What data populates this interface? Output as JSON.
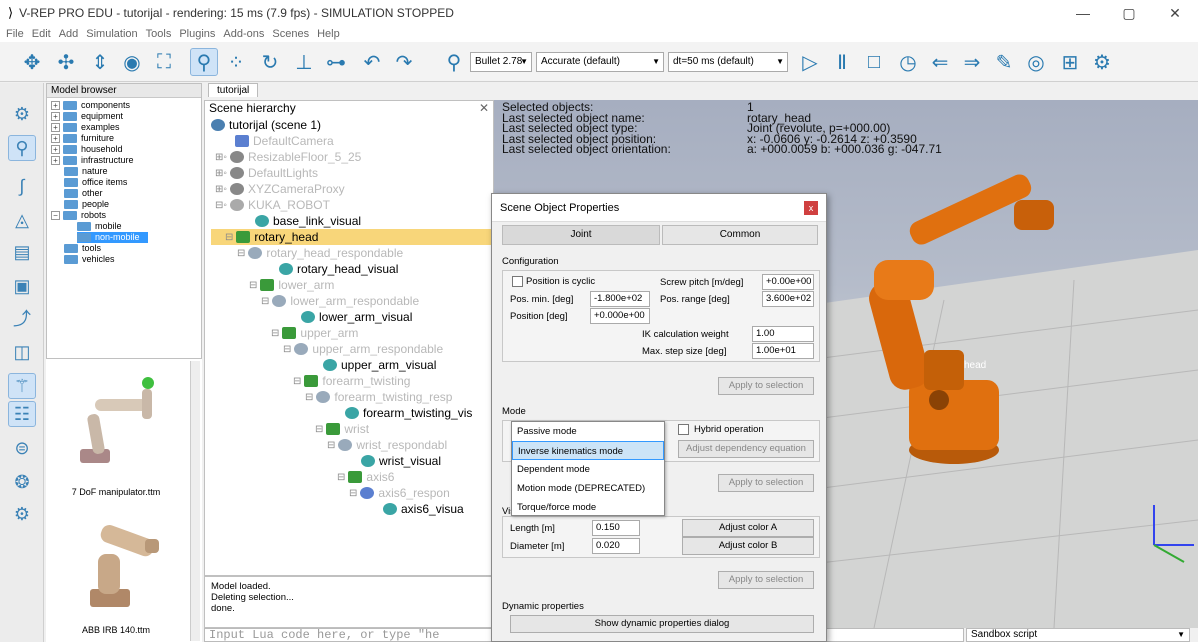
{
  "window": {
    "title": "V-REP PRO EDU - tutorijal - rendering: 15 ms (7.9 fps) - SIMULATION STOPPED",
    "controls": [
      "—",
      "▢",
      "✕"
    ]
  },
  "menu": [
    "File",
    "Edit",
    "Add",
    "Simulation",
    "Tools",
    "Plugins",
    "Add-ons",
    "Scenes",
    "Help"
  ],
  "toolbar": {
    "engine": "Bullet 2.78",
    "accuracy": "Accurate (default)",
    "timestep": "dt=50 ms (default)"
  },
  "model_browser": {
    "header": "Model browser",
    "items": [
      {
        "label": "components",
        "expander": "+"
      },
      {
        "label": "equipment",
        "expander": "+"
      },
      {
        "label": "examples",
        "expander": "+"
      },
      {
        "label": "furniture",
        "expander": "+"
      },
      {
        "label": "household",
        "expander": "+"
      },
      {
        "label": "infrastructure",
        "expander": "+"
      },
      {
        "label": "nature",
        "expander": ""
      },
      {
        "label": "office items",
        "expander": ""
      },
      {
        "label": "other",
        "expander": ""
      },
      {
        "label": "people",
        "expander": ""
      },
      {
        "label": "robots",
        "expander": "−"
      },
      {
        "label": "mobile",
        "expander": ""
      },
      {
        "label": "non-mobile",
        "expander": ""
      },
      {
        "label": "tools",
        "expander": ""
      },
      {
        "label": "vehicles",
        "expander": ""
      }
    ],
    "thumbs": [
      "7 DoF manipulator.ttm",
      "ABB IRB 140.ttm"
    ]
  },
  "scene_tab": "tutorijal",
  "hierarchy": {
    "title": "Scene hierarchy",
    "close": "✕",
    "nodes": [
      "tutorijal (scene 1)",
      "DefaultCamera",
      "ResizableFloor_5_25",
      "DefaultLights",
      "XYZCameraProxy",
      "KUKA_ROBOT",
      "base_link_visual",
      "rotary_head",
      "rotary_head_respondable",
      "rotary_head_visual",
      "lower_arm",
      "lower_arm_respondable",
      "lower_arm_visual",
      "upper_arm",
      "upper_arm_respondable",
      "upper_arm_visual",
      "forearm_twisting",
      "forearm_twisting_resp",
      "forearm_twisting_vis",
      "wrist",
      "wrist_respondabl",
      "wrist_visual",
      "axis6",
      "axis6_respon",
      "axis6_visua"
    ]
  },
  "console": {
    "lines": [
      "Model loaded.",
      "Deleting selection...",
      "done."
    ]
  },
  "lua_input": {
    "placeholder": "Input Lua code here, or type \"he"
  },
  "sandbox": {
    "label": "Sandbox script"
  },
  "selection": {
    "rows": [
      {
        "k": "Selected objects:",
        "v": "1"
      },
      {
        "k": "Last selected object name:",
        "v": "rotary_head"
      },
      {
        "k": "Last selected object type:",
        "v": "Joint (revolute, p=+000.00)"
      },
      {
        "k": "Last selected object position:",
        "v": "x: -0.0606   y: -0.2614   z: +0.3590"
      },
      {
        "k": "Last selected object orientation:",
        "v": "a: +000.0059   b: +000.036   g: -047.71"
      }
    ]
  },
  "viewport": {
    "floor_label": "head"
  },
  "dialog": {
    "title": "Scene Object Properties",
    "close": "x",
    "tabs": [
      "Joint",
      "Common"
    ],
    "config": {
      "title": "Configuration",
      "cyclic": "Position is cyclic",
      "screw_pitch_label": "Screw pitch [m/deg]",
      "screw_pitch": "+0.00e+00",
      "pos_min_label": "Pos. min. [deg]",
      "pos_min": "-1.800e+02",
      "pos_range_label": "Pos. range [deg]",
      "pos_range": "3.600e+02",
      "position_label": "Position [deg]",
      "position": "+0.000e+00",
      "ik_weight_label": "IK calculation weight",
      "ik_weight": "1.00",
      "max_step_label": "Max. step size [deg]",
      "max_step": "1.00e+01",
      "apply": "Apply to selection"
    },
    "mode": {
      "title": "Mode",
      "hybrid": "Hybrid operation",
      "adjust_dep": "Adjust dependency equation",
      "apply": "Apply to selection",
      "options": [
        "Passive mode",
        "Inverse kinematics mode",
        "Dependent mode",
        "Motion mode (DEPRECATED)",
        "Torque/force mode"
      ]
    },
    "visual": {
      "title_prefix": "Vis",
      "length_label": "Length [m]",
      "length": "0.150",
      "diameter_label": "Diameter [m]",
      "diameter": "0.020",
      "color_a": "Adjust color A",
      "color_b": "Adjust color B",
      "apply": "Apply to selection"
    },
    "dynamic": {
      "title": "Dynamic properties",
      "button": "Show dynamic properties dialog"
    }
  },
  "colors": {
    "selection": "#f8d67a",
    "robot": "#e0700f",
    "accent": "#3399ff"
  }
}
